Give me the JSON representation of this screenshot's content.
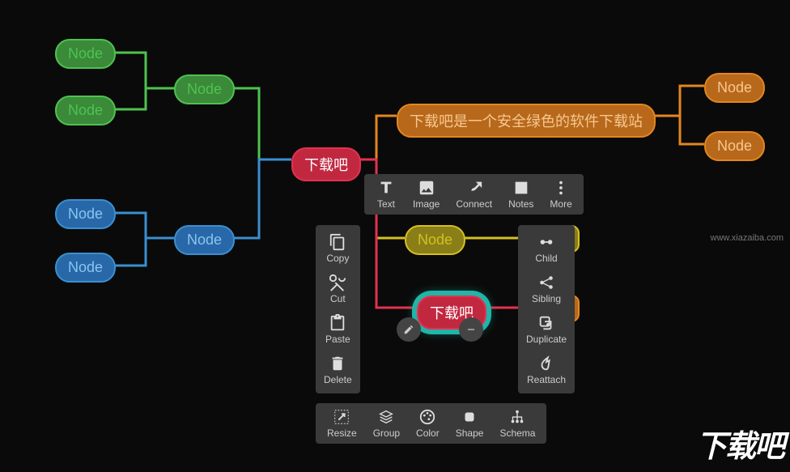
{
  "nodes": {
    "root": "下载吧",
    "generic": "Node",
    "orange_long": "下载吧是一个安全绿色的软件下载站",
    "selected": "下载吧"
  },
  "toolbar_top": {
    "text": "Text",
    "image": "Image",
    "connect": "Connect",
    "notes": "Notes",
    "more": "More"
  },
  "toolbar_left": {
    "copy": "Copy",
    "cut": "Cut",
    "paste": "Paste",
    "delete": "Delete"
  },
  "toolbar_right": {
    "child": "Child",
    "sibling": "Sibling",
    "duplicate": "Duplicate",
    "reattach": "Reattach"
  },
  "toolbar_bottom": {
    "resize": "Resize",
    "group": "Group",
    "color": "Color",
    "shape": "Shape",
    "schema": "Schema"
  },
  "watermark": "www.xiazaiba.com",
  "logo": "下载吧"
}
